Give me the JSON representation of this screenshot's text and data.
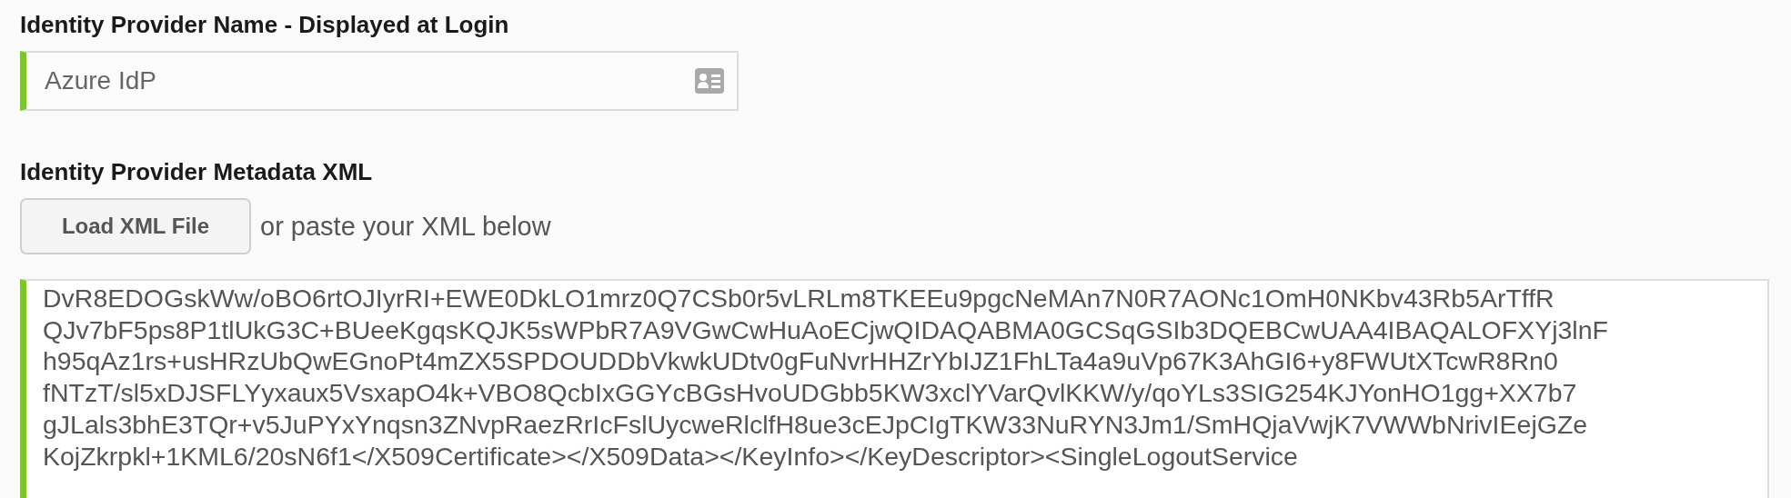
{
  "name_field": {
    "label": "Identity Provider Name - Displayed at Login",
    "value": "Azure IdP"
  },
  "metadata": {
    "label": "Identity Provider Metadata XML",
    "load_button": "Load XML File",
    "hint": "or paste your XML below",
    "xml_lines": [
      "DvR8EDOGskWw/oBO6rtOJIyrRI+EWE0DkLO1mrz0Q7CSb0r5vLRLm8TKEEu9pgcNeMAn7N0R7AONc1OmH0NKbv43Rb5ArTffR",
      "QJv7bF5ps8P1tlUkG3C+BUeeKgqsKQJK5sWPbR7A9VGwCwHuAoECjwQIDAQABMA0GCSqGSIb3DQEBCwUAA4IBAQALOFXYj3lnF",
      "h95qAz1rs+usHRzUbQwEGnoPt4mZX5SPDOUDDbVkwkUDtv0gFuNvrHHZrYbIJZ1FhLTa4a9uVp67K3AhGI6+y8FWUtXTcwR8Rn0",
      "fNTzT/sl5xDJSFLYyxaux5VsxapO4k+VBO8QcbIxGGYcBGsHvoUDGbb5KW3xclYVarQvlKKW/y/qoYLs3SIG254KJYonHO1gg+XX7b7",
      "gJLals3bhE3TQr+v5JuPYxYnqsn3ZNvpRaezRrIcFslUycweRlclfH8ue3cEJpCIgTKW33NuRYN3Jm1/SmHQjaVwjK7VWWbNrivIEejGZe",
      "KojZkrpkl+1KML6/20sN6f1</X509Certificate></X509Data></KeyInfo></KeyDescriptor><SingleLogoutService"
    ]
  }
}
